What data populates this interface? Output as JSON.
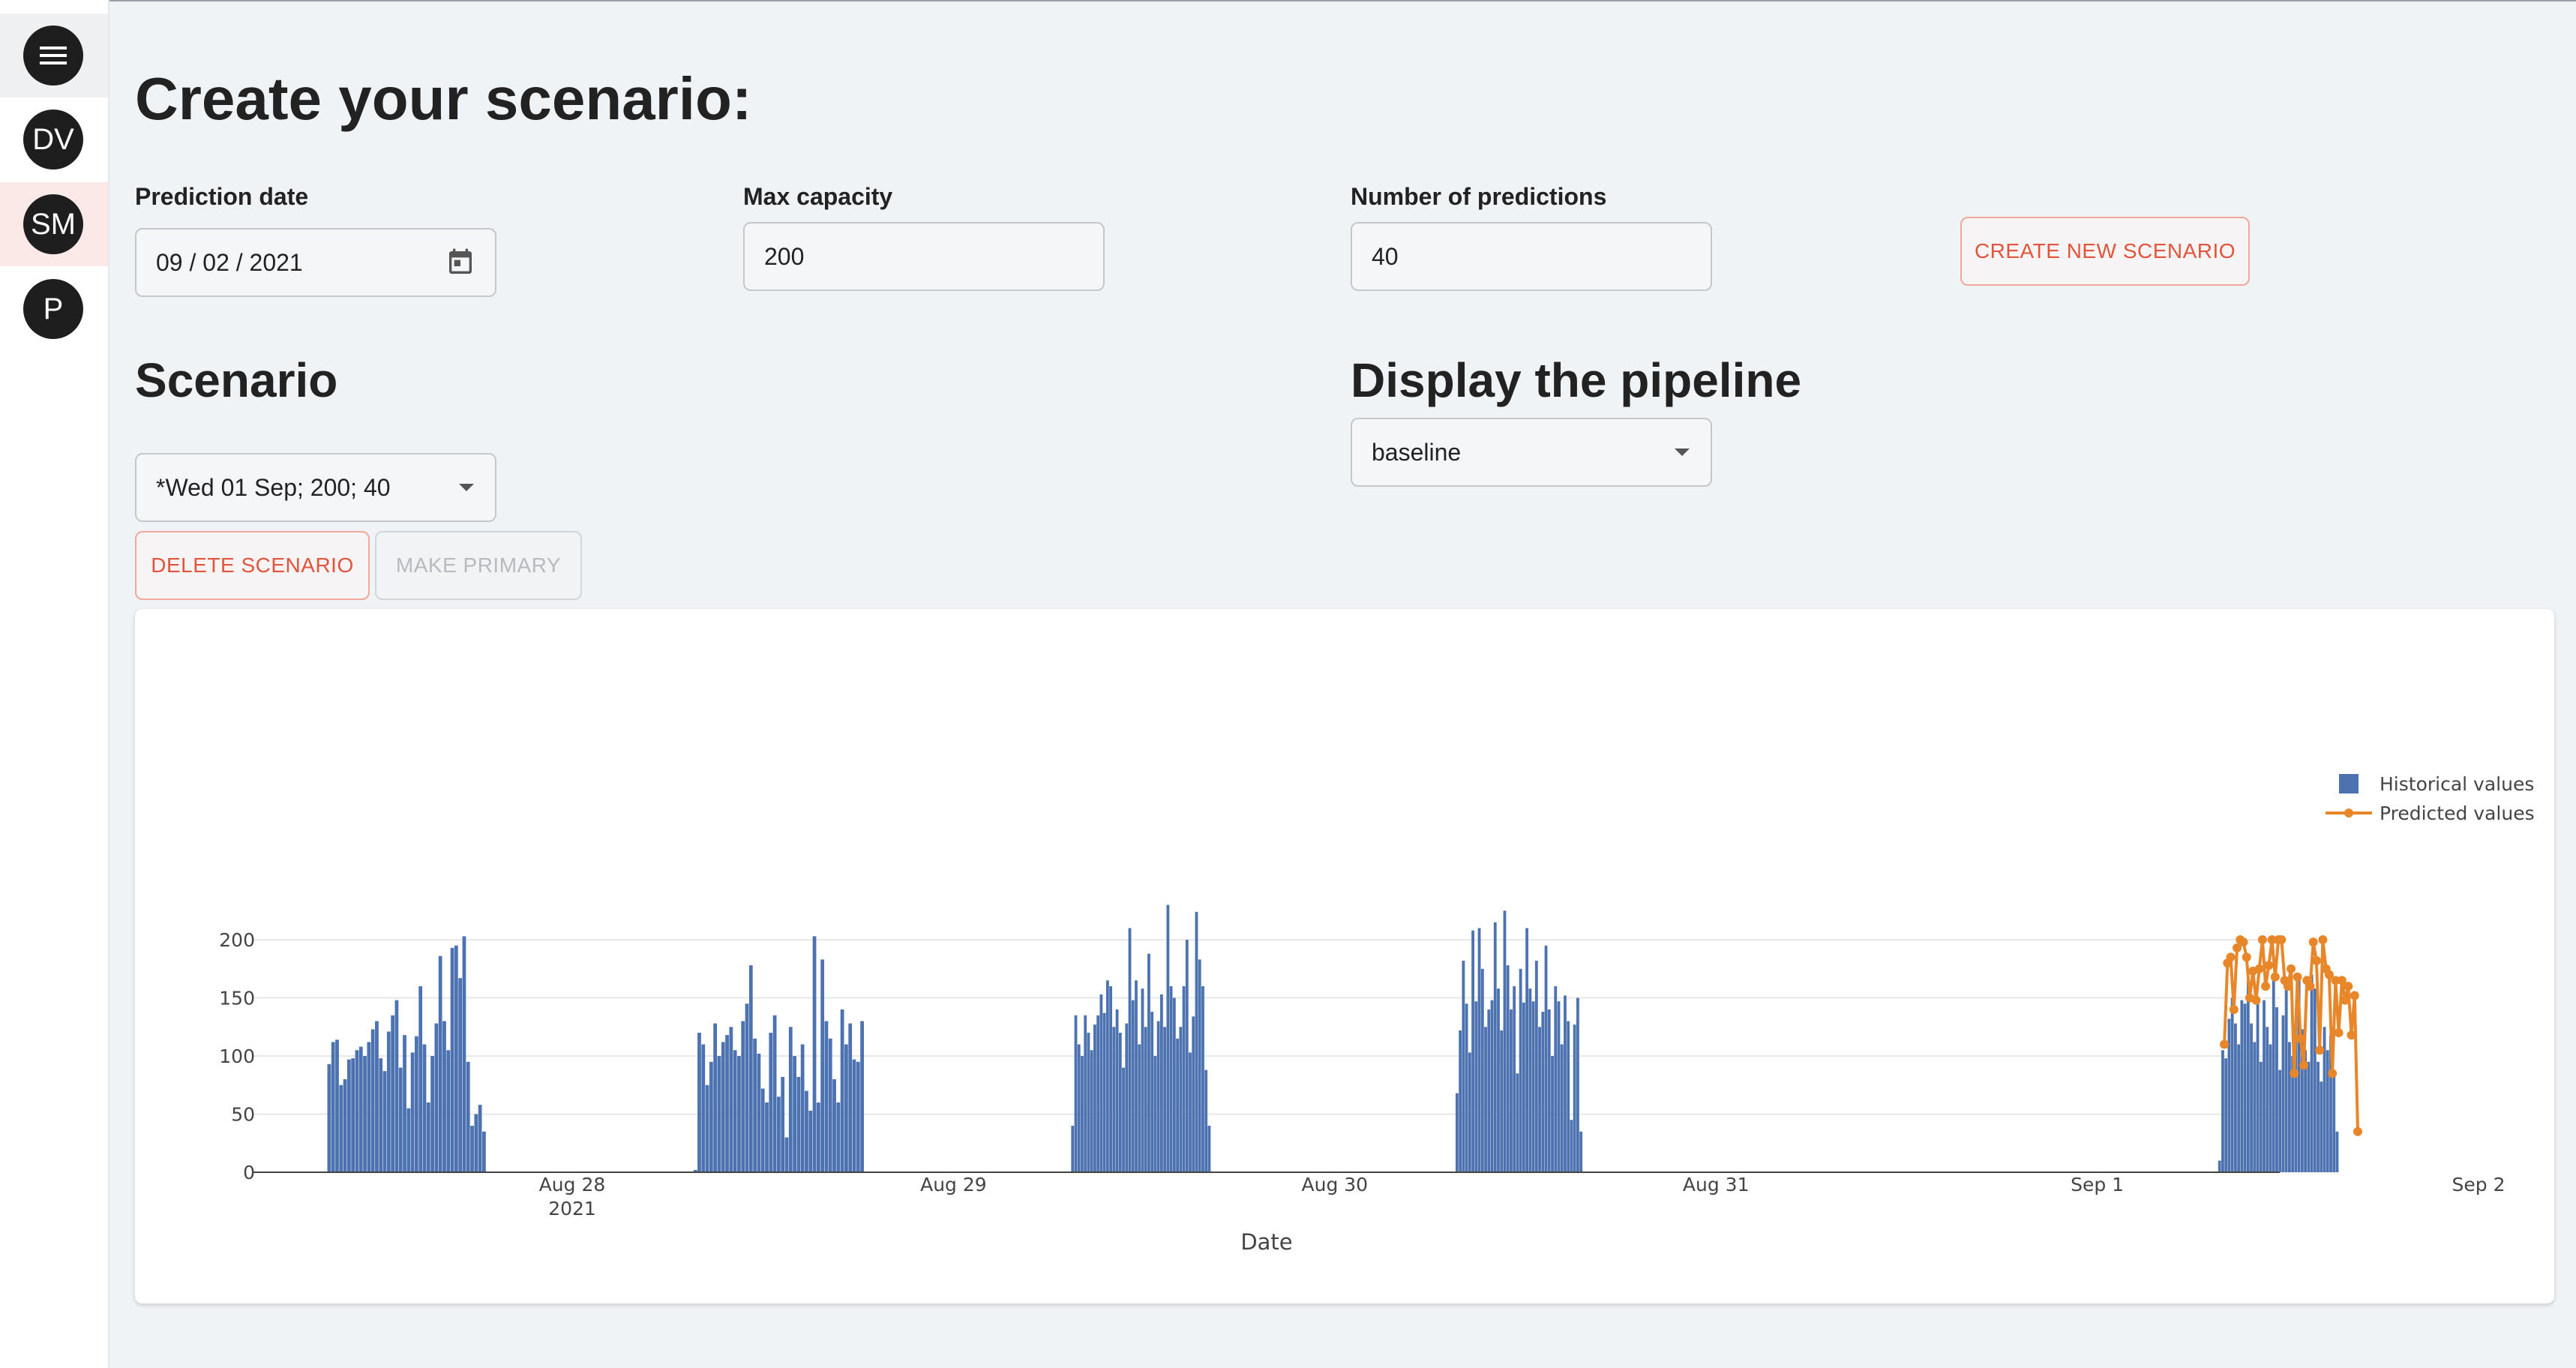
{
  "sidebar": {
    "items": [
      {
        "icon": "menu-icon"
      },
      {
        "initials": "DV"
      },
      {
        "initials": "SM"
      },
      {
        "initials": "P"
      }
    ]
  },
  "page": {
    "title": "Create your scenario:"
  },
  "form": {
    "prediction_date": {
      "label": "Prediction date",
      "value": "09 / 02 / 2021",
      "icon": "calendar-icon"
    },
    "max_capacity": {
      "label": "Max capacity",
      "value": "200"
    },
    "num_predictions": {
      "label": "Number of predictions",
      "value": "40"
    },
    "create_button": "CREATE NEW SCENARIO"
  },
  "scenario": {
    "title": "Scenario",
    "selected": "*Wed 01 Sep; 200; 40",
    "delete_button": "DELETE SCENARIO",
    "primary_button": "MAKE PRIMARY"
  },
  "pipeline": {
    "title": "Display the pipeline",
    "selected": "baseline"
  },
  "colors": {
    "accent": "#e0553c",
    "historical": "#4c72b0",
    "predicted": "#e8862a"
  },
  "chart_data": {
    "type": "bar",
    "xlabel": "Date",
    "ylabel": "",
    "ylim": [
      0,
      230
    ],
    "xlim": [
      "2021-08-27 07:00",
      "2021-09-02 00:00"
    ],
    "y_ticks": [
      0,
      50,
      100,
      150,
      200
    ],
    "x_ticks": [
      {
        "label": "Aug 28",
        "sub": "2021",
        "at": "2021-08-28"
      },
      {
        "label": "Aug 29",
        "sub": "",
        "at": "2021-08-29"
      },
      {
        "label": "Aug 30",
        "sub": "",
        "at": "2021-08-30"
      },
      {
        "label": "Aug 31",
        "sub": "",
        "at": "2021-08-31"
      },
      {
        "label": "Sep 1",
        "sub": "",
        "at": "2021-09-01"
      },
      {
        "label": "Sep 2",
        "sub": "",
        "at": "2021-09-02"
      }
    ],
    "legend": {
      "position": "top-right",
      "entries": [
        "Historical values",
        "Predicted values"
      ]
    },
    "series": [
      {
        "name": "Historical values",
        "kind": "bar",
        "days": [
          {
            "date": "2021-08-27",
            "start_hour": 8.7,
            "step_hours": 0.25,
            "values": [
              93,
              112,
              114,
              75,
              80,
              97,
              98,
              105,
              108,
              100,
              112,
              123,
              130,
              98,
              87,
              121,
              135,
              148,
              90,
              118,
              55,
              103,
              117,
              160,
              110,
              60,
              100,
              128,
              186,
              130,
              105,
              193,
              195,
              167,
              203,
              95,
              40,
              50,
              58,
              35
            ]
          },
          {
            "date": "2021-08-28",
            "start_hour": 7.75,
            "step_hours": 0.25,
            "values": [
              2,
              120,
              110,
              75,
              95,
              128,
              100,
              112,
              118,
              125,
              105,
              100,
              130,
              145,
              178,
              115,
              102,
              72,
              60,
              120,
              135,
              65,
              82,
              30,
              125,
              100,
              82,
              110,
              70,
              53,
              203,
              60,
              183,
              130,
              115,
              80,
              60,
              140,
              110,
              128,
              97,
              95,
              130
            ]
          },
          {
            "date": "2021-08-29",
            "start_hour": 7.5,
            "step_hours": 0.2,
            "values": [
              40,
              135,
              110,
              100,
              135,
              120,
              105,
              127,
              135,
              153,
              137,
              165,
              160,
              125,
              140,
              120,
              90,
              128,
              210,
              148,
              165,
              110,
              158,
              125,
              188,
              138,
              100,
              130,
              153,
              125,
              230,
              160,
              150,
              115,
              125,
              160,
              200,
              103,
              134,
              224,
              183,
              160,
              88,
              40
            ]
          },
          {
            "date": "2021-08-30",
            "start_hour": 7.7,
            "step_hours": 0.2,
            "values": [
              68,
              122,
              182,
              145,
              103,
              208,
              147,
              210,
              175,
              125,
              140,
              148,
              215,
              158,
              122,
              225,
              178,
              140,
              160,
              85,
              175,
              146,
              210,
              158,
              147,
              182,
              125,
              138,
              195,
              140,
              100,
              160,
              147,
              110,
              152,
              130,
              45,
              127,
              150,
              35
            ]
          },
          {
            "date": "2021-09-01",
            "start_hour": 7.7,
            "step_hours": 0.2,
            "values": [
              10,
              105,
              98,
              132,
              150,
              128,
              110,
              148,
              145,
              165,
              128,
              112,
              150,
              95,
              148,
              125,
              110,
              165,
              142,
              88,
              135,
              160,
              112,
              100,
              128,
              165,
              123,
              105,
              95,
              170,
              158,
              95,
              78,
              125,
              105,
              118,
              85,
              35
            ]
          }
        ]
      },
      {
        "name": "Predicted values",
        "kind": "line",
        "start": "2021-09-01 08:00",
        "step_hours": 0.2,
        "values": [
          110,
          180,
          185,
          140,
          193,
          200,
          198,
          185,
          150,
          173,
          148,
          175,
          200,
          160,
          178,
          200,
          168,
          200,
          200,
          165,
          160,
          175,
          85,
          168,
          115,
          92,
          165,
          160,
          198,
          182,
          105,
          200,
          175,
          170,
          85,
          165,
          120,
          165,
          148,
          160,
          118,
          152,
          35
        ]
      }
    ]
  }
}
